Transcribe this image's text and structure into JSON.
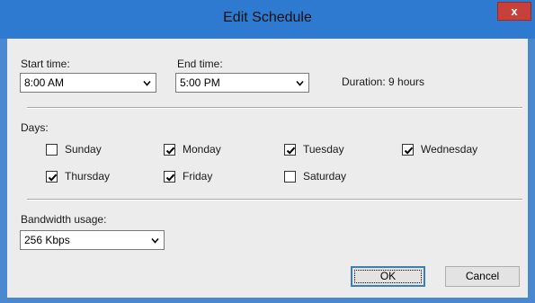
{
  "window": {
    "title": "Edit Schedule",
    "close_label": "x"
  },
  "schedule": {
    "start_label": "Start time:",
    "start_value": "8:00 AM",
    "end_label": "End time:",
    "end_value": "5:00 PM",
    "duration_text": "Duration: 9 hours"
  },
  "days": {
    "label": "Days:",
    "items": [
      {
        "label": "Sunday",
        "checked": false
      },
      {
        "label": "Monday",
        "checked": true
      },
      {
        "label": "Tuesday",
        "checked": true
      },
      {
        "label": "Wednesday",
        "checked": true
      },
      {
        "label": "Thursday",
        "checked": true
      },
      {
        "label": "Friday",
        "checked": true
      },
      {
        "label": "Saturday",
        "checked": false
      }
    ]
  },
  "bandwidth": {
    "label": "Bandwidth usage:",
    "value": "256 Kbps"
  },
  "buttons": {
    "ok": "OK",
    "cancel": "Cancel"
  },
  "colors": {
    "titlebar": "#2e7ad0",
    "close": "#c8403a",
    "background": "#ececec"
  }
}
